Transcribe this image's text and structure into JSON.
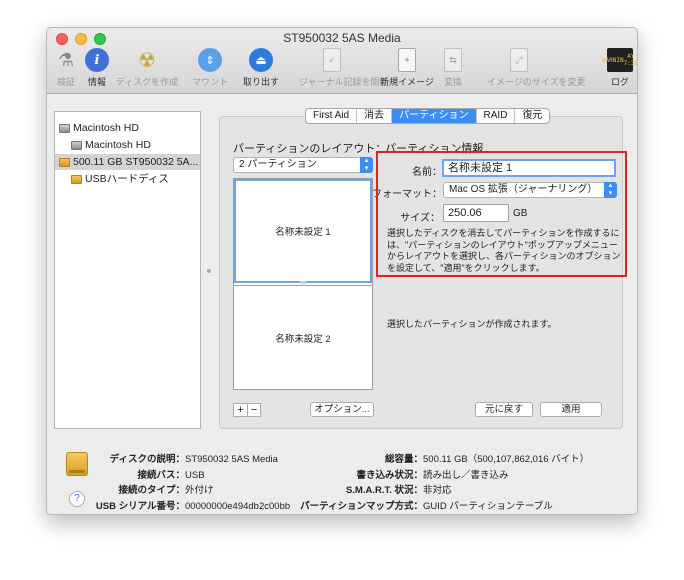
{
  "window": {
    "title": "ST950032 5AS Media"
  },
  "toolbar": {
    "verify": "検証",
    "info": "情報",
    "burn": "ディスクを作成",
    "mount": "マウント",
    "eject": "取り出す",
    "journal": "ジャーナル記録を開始",
    "new_image": "新規イメージ",
    "convert": "変換",
    "resize_image": "イメージのサイズを変更",
    "log": "ログ",
    "log_icon_text_1": "WARNIN",
    "log_icon_text_2": "AY 7:36"
  },
  "sidebar": {
    "items": [
      {
        "label": "Macintosh HD",
        "icon": "internal-disk-icon"
      },
      {
        "label": "Macintosh HD",
        "icon": "volume-icon"
      },
      {
        "label": "500.11 GB ST950032 5A...",
        "icon": "external-disk-icon"
      },
      {
        "label": "USBハードディス",
        "icon": "usb-volume-icon"
      }
    ]
  },
  "tabs": [
    {
      "label": "First Aid"
    },
    {
      "label": "消去"
    },
    {
      "label": "パーティション",
      "active": true
    },
    {
      "label": "RAID"
    },
    {
      "label": "復元"
    }
  ],
  "layout": {
    "heading": "パーティションのレイアウト：",
    "popup_value": "2 パーティション",
    "partitions": [
      "名称未設定 1",
      "名称未設定 2"
    ],
    "add_label": "+",
    "remove_label": "−",
    "options_label": "オプション..."
  },
  "info": {
    "heading": "パーティション情報",
    "name_label": "名前：",
    "name_value": "名称未設定 1",
    "format_label": "フォーマット：",
    "format_value": "Mac OS 拡張（ジャーナリング）",
    "size_label": "サイズ：",
    "size_value": "250.06",
    "size_unit": "GB",
    "instructions": "選択したディスクを消去してパーティションを作成するには、\"パーティションのレイアウト\"ポップアップメニューからレイアウトを選択し、各パーティションのオプションを設定して、\"適用\"をクリックします。",
    "status": "選択したパーティションが作成されます。",
    "revert_label": "元に戻す",
    "apply_label": "適用"
  },
  "bottom": {
    "desc_label": "ディスクの説明：",
    "desc_value": "ST950032 5AS Media",
    "bus_label": "接続バス：",
    "bus_value": "USB",
    "type_label": "接続のタイプ：",
    "type_value": "外付け",
    "serial_label": "USB シリアル番号：",
    "serial_value": "00000000e494db2c00bb",
    "capacity_label": "総容量：",
    "capacity_value": "500.11 GB（500,107,862,016 バイト）",
    "write_label": "書き込み状況：",
    "write_value": "読み出し／書き込み",
    "smart_label": "S.M.A.R.T. 状況：",
    "smart_value": "非対応",
    "map_label": "パーティションマップ方式：",
    "map_value": "GUID パーティションテーブル",
    "help": "?"
  },
  "colors": {
    "accent": "#3d8ef3",
    "highlight": "#e12222",
    "selected_row": "#d4d4d4"
  }
}
